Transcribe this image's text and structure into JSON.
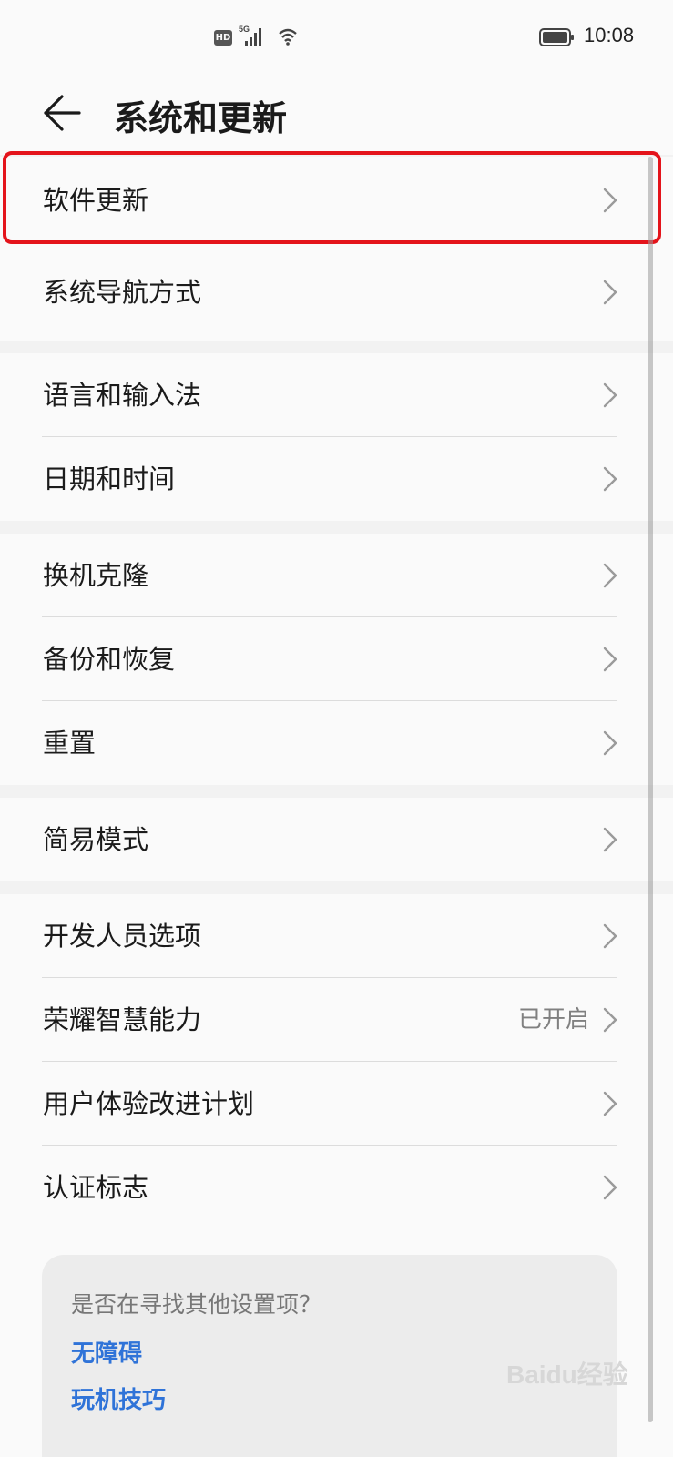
{
  "status_bar": {
    "hd": "HD",
    "network": "5G",
    "time": "10:08"
  },
  "header": {
    "title": "系统和更新"
  },
  "groups": [
    {
      "items": [
        {
          "label": "软件更新"
        },
        {
          "label": "系统导航方式"
        }
      ]
    },
    {
      "items": [
        {
          "label": "语言和输入法"
        },
        {
          "label": "日期和时间"
        }
      ]
    },
    {
      "items": [
        {
          "label": "换机克隆"
        },
        {
          "label": "备份和恢复"
        },
        {
          "label": "重置"
        }
      ]
    },
    {
      "items": [
        {
          "label": "简易模式"
        }
      ]
    },
    {
      "items": [
        {
          "label": "开发人员选项"
        },
        {
          "label": "荣耀智慧能力",
          "value": "已开启"
        },
        {
          "label": "用户体验改进计划"
        },
        {
          "label": "认证标志"
        }
      ]
    }
  ],
  "suggestion_card": {
    "question": "是否在寻找其他设置项？",
    "links": [
      "无障碍",
      "玩机技巧"
    ]
  },
  "watermark": "Baidu经验",
  "colors": {
    "accent_link": "#2f73d8",
    "highlight_border": "#e4141b"
  }
}
